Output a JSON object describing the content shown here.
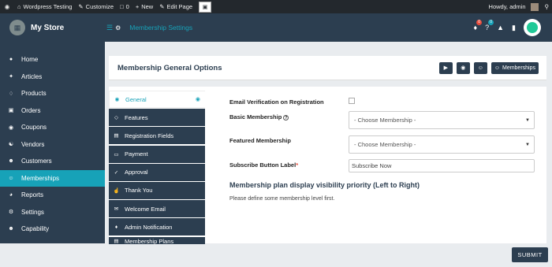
{
  "admin_bar": {
    "site_name": "Wordpress Testing",
    "customize": "Customize",
    "comments_count": "0",
    "new": "New",
    "edit_page": "Edit Page",
    "howdy": "Howdy, admin"
  },
  "header": {
    "store_name": "My Store",
    "page_title": "Membership Settings",
    "notif_badge_1": "0",
    "notif_badge_2": "0"
  },
  "sidebar": {
    "items": [
      {
        "label": "Home",
        "icon": "home-icon"
      },
      {
        "label": "Articles",
        "icon": "articles-icon"
      },
      {
        "label": "Products",
        "icon": "products-icon"
      },
      {
        "label": "Orders",
        "icon": "cart-icon"
      },
      {
        "label": "Coupons",
        "icon": "gift-icon"
      },
      {
        "label": "Vendors",
        "icon": "vendor-icon"
      },
      {
        "label": "Customers",
        "icon": "users-icon"
      },
      {
        "label": "Memberships",
        "icon": "user-plus-icon"
      },
      {
        "label": "Reports",
        "icon": "pie-chart-icon"
      },
      {
        "label": "Settings",
        "icon": "cogs-icon"
      },
      {
        "label": "Capability",
        "icon": "user-times-icon"
      }
    ]
  },
  "panel": {
    "title": "Membership General Options",
    "memberships_button": "Memberships"
  },
  "tabs": [
    {
      "label": "General"
    },
    {
      "label": "Features"
    },
    {
      "label": "Registration Fields"
    },
    {
      "label": "Payment"
    },
    {
      "label": "Approval"
    },
    {
      "label": "Thank You"
    },
    {
      "label": "Welcome Email"
    },
    {
      "label": "Admin Notification"
    },
    {
      "label": "Membership Plans"
    }
  ],
  "form": {
    "email_verification_label": "Email Verification on Registration",
    "basic_membership_label": "Basic Membership",
    "basic_membership_value": "- Choose Membership -",
    "featured_membership_label": "Featured Membership",
    "featured_membership_value": "- Choose Membership -",
    "subscribe_label": "Subscribe Button Label",
    "subscribe_value": "Subscribe Now",
    "section_title": "Membership plan display visibility priority (Left to Right)",
    "section_note": "Please define some membership level first."
  },
  "submit_label": "SUBMIT",
  "colors": {
    "dark": "#2c3e50",
    "accent": "#17a2b8",
    "admin_bar": "#23282d"
  }
}
